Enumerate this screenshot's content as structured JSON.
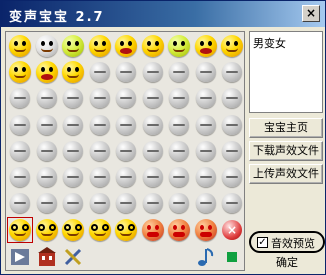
{
  "window": {
    "title": "变声宝宝 2.7",
    "close_label": "×"
  },
  "voice_panel": {
    "current_voice": "男变女"
  },
  "buttons": {
    "home": "宝宝主页",
    "download": "下载声效文件",
    "upload": "上传声效文件",
    "confirm": "确定"
  },
  "preview": {
    "label": "音效预览",
    "checked": true,
    "check_mark": "✓"
  },
  "grid": {
    "rows": 8,
    "cols": 9,
    "row1_icons": [
      "smile-icon",
      "grin-icon",
      "green-smile-icon",
      "teeth-icon",
      "laugh-icon",
      "sun-face-icon",
      "tongue-icon",
      "shock-icon",
      "wide-eye-icon"
    ],
    "row2_icons": [
      "tongue-out-icon",
      "surprised-icon",
      "monster-icon"
    ]
  },
  "bottom_strip": {
    "row1_icons": [
      "glasses-face-icon",
      "glasses-face-icon",
      "glasses-face-icon",
      "glasses-face-icon",
      "glasses-face-icon",
      "heart-face-icon",
      "heart-face-icon",
      "heart-face-icon",
      "delete-icon"
    ],
    "row2_icons": [
      "arrow-icon",
      "building-icon",
      "tools-icon",
      "blank",
      "blank",
      "blank",
      "blank",
      "music-note-icon",
      "stop-icon"
    ],
    "delete_label": "×"
  }
}
